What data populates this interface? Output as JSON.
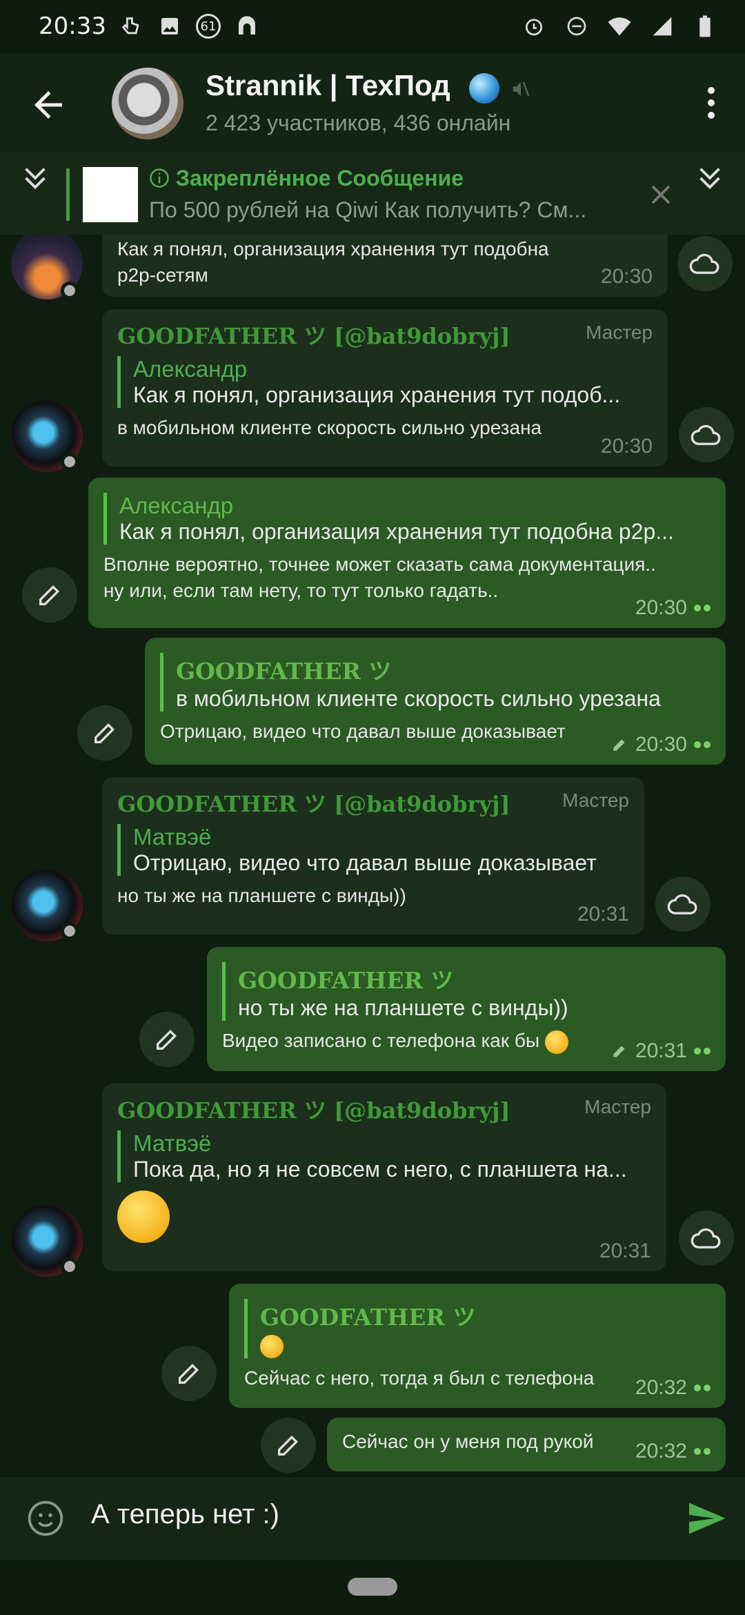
{
  "status_bar": {
    "time": "20:33",
    "notification_count": "61"
  },
  "header": {
    "title": "Strannik | ТехПод",
    "subtitle": "2 423 участников, 436 онлайн"
  },
  "pinned": {
    "title": "Закреплённое Сообщение",
    "text": "По 500 рублей на Qiwi   Как получить? См..."
  },
  "messages": [
    {
      "text": "Как я понял, организация хранения тут подобна\np2p-сетям",
      "time": "20:30"
    },
    {
      "sender": "GOODFATHER ツ [@bat9dobryj]",
      "role": "Мастер",
      "reply_name": "Александр",
      "reply_text": "Как я понял, организация хранения тут подоб...",
      "text": "в мобильном клиенте скорость сильно урезана",
      "time": "20:30"
    },
    {
      "reply_name": "Александр",
      "reply_text": "Как я понял, организация хранения тут подобна p2p...",
      "text": "Вполне вероятно, точнее может сказать сама документация..\nну или, если там нету, то тут только гадать..",
      "time": "20:30"
    },
    {
      "reply_name": "GOODFATHER ツ",
      "reply_text": "в мобильном клиенте скорость сильно урезана",
      "text": "Отрицаю, видео что давал выше доказывает",
      "time": "20:30"
    },
    {
      "sender": "GOODFATHER ツ [@bat9dobryj]",
      "role": "Мастер",
      "reply_name": "Матвэё",
      "reply_text": "Отрицаю, видео что давал выше доказывает",
      "text": "но ты же на планшете с винды))",
      "time": "20:31"
    },
    {
      "reply_name": "GOODFATHER ツ",
      "reply_text": "но ты же на планшете с винды))",
      "text": "Видео записано с телефона как бы",
      "time": "20:31"
    },
    {
      "sender": "GOODFATHER ツ [@bat9dobryj]",
      "role": "Мастер",
      "reply_name": "Матвэё",
      "reply_text": "Пока да, но я не совсем с него, с планшета на...",
      "time": "20:31"
    },
    {
      "reply_name": "GOODFATHER ツ",
      "text": "Сейчас с него, тогда я был с телефона",
      "time": "20:32"
    },
    {
      "text": "Сейчас он у меня под рукой",
      "time": "20:32"
    }
  ],
  "input": {
    "text": "А теперь нет :)"
  },
  "colors": {
    "accent": "#4caf50",
    "outgoing_bubble": "#2b5a24",
    "incoming_bubble": "#1c2e1c",
    "background": "#0f1c10"
  }
}
